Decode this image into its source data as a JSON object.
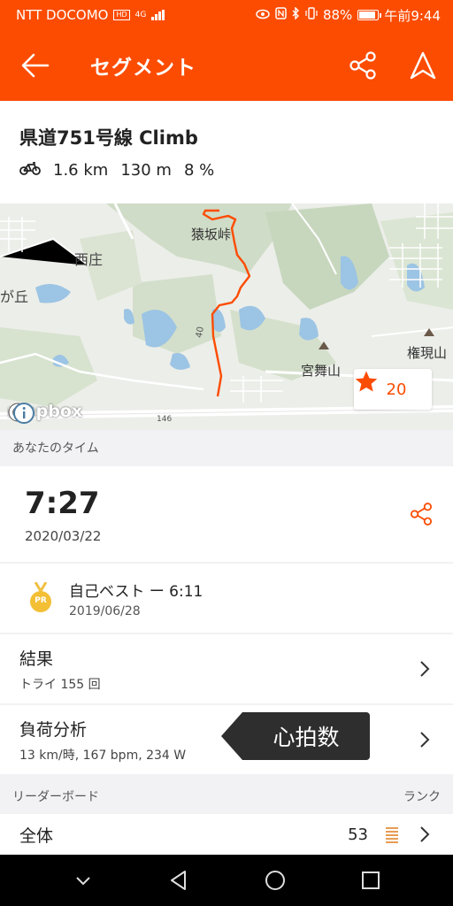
{
  "status": {
    "carrier": "NTT DOCOMO",
    "hd": "HD",
    "network": "4G",
    "battery": "88%",
    "time": "午前9:44"
  },
  "appbar": {
    "title": "セグメント",
    "icons": [
      "back-arrow-icon",
      "share-icon",
      "navigate-icon"
    ]
  },
  "segment": {
    "name": "県道751号線 Climb",
    "distance": "1.6 km",
    "elevation": "130 m",
    "grade": "8 %"
  },
  "map": {
    "labels": {
      "saruzaka": "猿坂峠",
      "nishisho": "西庄",
      "gaoka": "が丘",
      "miyamaiyama": "宮舞山",
      "gongenyama": "権現山",
      "route146": "146",
      "route40": "40"
    },
    "favorite_count": "20",
    "attribution": "mapbox"
  },
  "your_time": {
    "section_label": "あなたのタイム",
    "time": "7:27",
    "date": "2020/03/22"
  },
  "pr": {
    "badge": "PR",
    "label": "自己ベスト ー 6:11",
    "date": "2019/06/28"
  },
  "results": {
    "label": "結果",
    "sub": "トライ 155 回"
  },
  "analysis": {
    "label": "負荷分析",
    "sub": "13 km/時, 167 bpm, 234 W",
    "tooltip": "心拍数"
  },
  "leaderboard": {
    "section_label": "リーダーボード",
    "rank_label": "ランク",
    "overall_label": "全体",
    "overall_rank": "53"
  },
  "colors": {
    "brand": "#fc4c02",
    "tooltip_bg": "#2e2e2e"
  }
}
